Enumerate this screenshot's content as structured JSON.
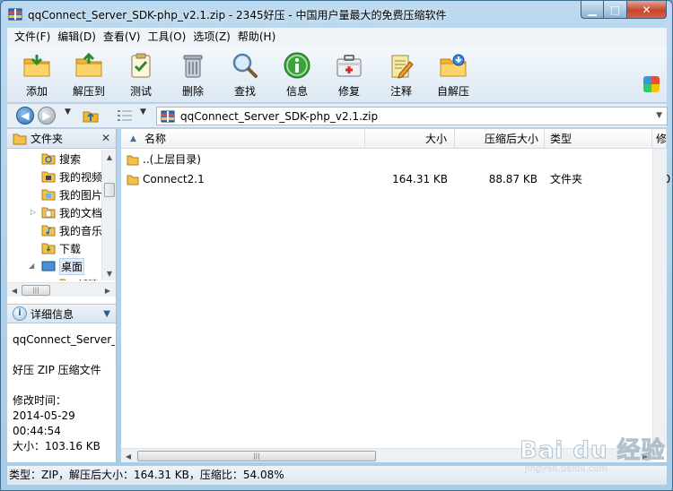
{
  "window": {
    "title": "qqConnect_Server_SDK-php_v2.1.zip - 2345好压 - 中国用户量最大的免费压缩软件"
  },
  "menu": [
    {
      "label": "文件(F)"
    },
    {
      "label": "编辑(D)"
    },
    {
      "label": "查看(V)"
    },
    {
      "label": "工具(O)"
    },
    {
      "label": "选项(Z)"
    },
    {
      "label": "帮助(H)"
    }
  ],
  "toolbar": {
    "add": "添加",
    "extract": "解压到",
    "test": "测试",
    "delete": "删除",
    "find": "查找",
    "info": "信息",
    "repair": "修复",
    "comment": "注释",
    "sfx": "自解压"
  },
  "address": {
    "path": "qqConnect_Server_SDK-php_v2.1.zip"
  },
  "folders_pane": {
    "title": "文件夹",
    "close": "✕",
    "items": [
      "搜索",
      "我的视频",
      "我的图片",
      "我的文档",
      "我的音乐",
      "下载",
      "桌面",
      "新建"
    ]
  },
  "details_pane": {
    "title": "详细信息",
    "lines": [
      "qqConnect_Server_",
      "",
      "好压 ZIP 压缩文件",
      "",
      "修改时间：",
      "2014-05-29",
      "00:44:54",
      "大小：103.16 KB"
    ]
  },
  "file_list": {
    "columns": {
      "name": "名称",
      "size": "大小",
      "packed": "压缩后大小",
      "type": "类型",
      "modified": "修"
    },
    "rows": [
      {
        "name": "..(上层目录)",
        "size": "",
        "packed": "",
        "type": "",
        "modified": ""
      },
      {
        "name": "Connect2.1",
        "size": "164.31 KB",
        "packed": "88.87 KB",
        "type": "文件夹",
        "modified": "20"
      }
    ]
  },
  "status": {
    "text": "类型：ZIP，解压后大小：164.31 KB，压缩比：54.08%"
  },
  "watermark": {
    "brand": "Bai du 经验",
    "sub": "jingyan.baidu.com"
  },
  "colors": {
    "frame": "#a8cbe6",
    "folder": "#f2c14e",
    "info_green": "#3aa33a"
  }
}
